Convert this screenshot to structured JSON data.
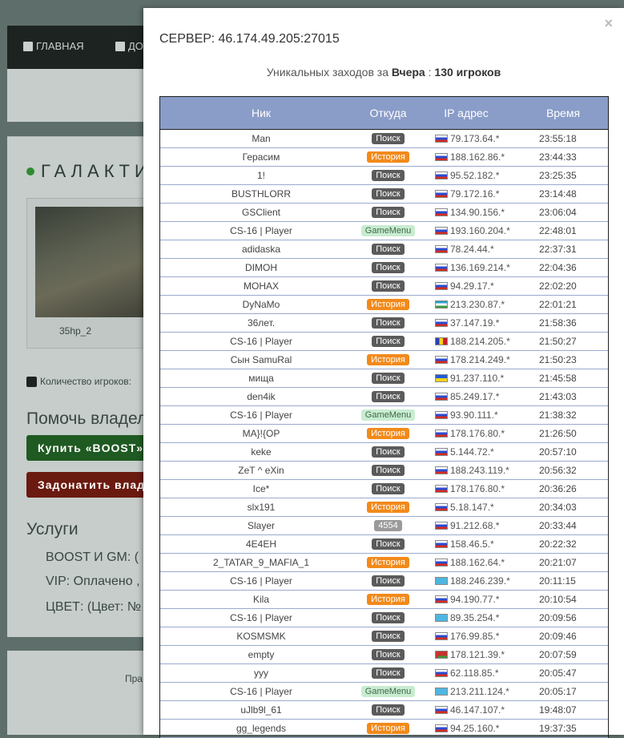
{
  "background": {
    "nav": [
      {
        "label": "ГЛАВНАЯ",
        "icon": "home-icon"
      },
      {
        "label": "ДО",
        "icon": "plus-square-icon"
      }
    ],
    "server_title": "ГАЛАКТИ",
    "map_name": "35hp_2",
    "players_label": "Количество игроков:",
    "help_heading": "Помочь владел",
    "buy_boost": "Купить «BOOST»",
    "donate": "Задонатить влад",
    "services_heading": "Услуги",
    "services": [
      "BOOST И GM:   (",
      "VIP:   Оплачено ,",
      "ЦВЕТ:   (Цвет: №"
    ],
    "footer_text": "Пра"
  },
  "modal": {
    "close": "×",
    "title": "СЕРВЕР: 46.174.49.205:27015",
    "unique_prefix": "Уникальных заходов за",
    "unique_period": "Вчера",
    "unique_sep": " : ",
    "unique_count": "130 игроков",
    "columns": {
      "nick": "Ник",
      "from": "Откуда",
      "ip": "IP адрес",
      "time": "Время"
    },
    "rows": [
      {
        "nick": "Man",
        "from": "Поиск",
        "type": "poisk",
        "flag": "ru",
        "ip": "79.173.64.*",
        "time": "23:55:18"
      },
      {
        "nick": "Герасим",
        "from": "История",
        "type": "ist",
        "flag": "ru",
        "ip": "188.162.86.*",
        "time": "23:44:33"
      },
      {
        "nick": "1!",
        "from": "Поиск",
        "type": "poisk",
        "flag": "ru",
        "ip": "95.52.182.*",
        "time": "23:25:35"
      },
      {
        "nick": "BUSTHLORR",
        "from": "Поиск",
        "type": "poisk",
        "flag": "ru",
        "ip": "79.172.16.*",
        "time": "23:14:48"
      },
      {
        "nick": "GSClient",
        "from": "Поиск",
        "type": "poisk",
        "flag": "ru",
        "ip": "134.90.156.*",
        "time": "23:06:04"
      },
      {
        "nick": "CS-16 | Player",
        "from": "GameMenu",
        "type": "gm",
        "flag": "ru",
        "ip": "193.160.204.*",
        "time": "22:48:01"
      },
      {
        "nick": "adidaska",
        "from": "Поиск",
        "type": "poisk",
        "flag": "ru",
        "ip": "78.24.44.*",
        "time": "22:37:31"
      },
      {
        "nick": "DIMOH",
        "from": "Поиск",
        "type": "poisk",
        "flag": "ru",
        "ip": "136.169.214.*",
        "time": "22:04:36"
      },
      {
        "nick": "MOHAX",
        "from": "Поиск",
        "type": "poisk",
        "flag": "ru",
        "ip": "94.29.17.*",
        "time": "22:02:20"
      },
      {
        "nick": "DyNaMo",
        "from": "История",
        "type": "ist",
        "flag": "uz",
        "ip": "213.230.87.*",
        "time": "22:01:21"
      },
      {
        "nick": "36лет.",
        "from": "Поиск",
        "type": "poisk",
        "flag": "ru",
        "ip": "37.147.19.*",
        "time": "21:58:36"
      },
      {
        "nick": "CS-16 | Player",
        "from": "Поиск",
        "type": "poisk",
        "flag": "md",
        "ip": "188.214.205.*",
        "time": "21:50:27"
      },
      {
        "nick": "Сын SamuRal",
        "from": "История",
        "type": "ist",
        "flag": "ru",
        "ip": "178.214.249.*",
        "time": "21:50:23"
      },
      {
        "nick": "мища",
        "from": "Поиск",
        "type": "poisk",
        "flag": "ua",
        "ip": "91.237.110.*",
        "time": "21:45:58"
      },
      {
        "nick": "den4ik",
        "from": "Поиск",
        "type": "poisk",
        "flag": "ru",
        "ip": "85.249.17.*",
        "time": "21:43:03"
      },
      {
        "nick": "CS-16 | Player",
        "from": "GameMenu",
        "type": "gm",
        "flag": "ru",
        "ip": "93.90.111.*",
        "time": "21:38:32"
      },
      {
        "nick": "MA}!{OP",
        "from": "История",
        "type": "ist",
        "flag": "ru",
        "ip": "178.176.80.*",
        "time": "21:26:50"
      },
      {
        "nick": "keke",
        "from": "Поиск",
        "type": "poisk",
        "flag": "ru",
        "ip": "5.144.72.*",
        "time": "20:57:10"
      },
      {
        "nick": "ZeT ^ eXin",
        "from": "Поиск",
        "type": "poisk",
        "flag": "ru",
        "ip": "188.243.119.*",
        "time": "20:56:32"
      },
      {
        "nick": "Ice*",
        "from": "Поиск",
        "type": "poisk",
        "flag": "ru",
        "ip": "178.176.80.*",
        "time": "20:36:26"
      },
      {
        "nick": "slx191",
        "from": "История",
        "type": "ist",
        "flag": "ru",
        "ip": "5.18.147.*",
        "time": "20:34:03"
      },
      {
        "nick": "Slayer",
        "from": "4554",
        "type": "num",
        "flag": "ru",
        "ip": "91.212.68.*",
        "time": "20:33:44"
      },
      {
        "nick": "4E4EH",
        "from": "Поиск",
        "type": "poisk",
        "flag": "ru",
        "ip": "158.46.5.*",
        "time": "20:22:32"
      },
      {
        "nick": "2_TATAR_9_MAFIA_1",
        "from": "История",
        "type": "ist",
        "flag": "ru",
        "ip": "188.162.64.*",
        "time": "20:21:07"
      },
      {
        "nick": "CS-16 | Player",
        "from": "Поиск",
        "type": "poisk",
        "flag": "kz",
        "ip": "188.246.239.*",
        "time": "20:11:15"
      },
      {
        "nick": "Kila",
        "from": "История",
        "type": "ist",
        "flag": "ru",
        "ip": "94.190.77.*",
        "time": "20:10:54"
      },
      {
        "nick": "CS-16 | Player",
        "from": "Поиск",
        "type": "poisk",
        "flag": "kz",
        "ip": "89.35.254.*",
        "time": "20:09:56"
      },
      {
        "nick": "KOSMSMK",
        "from": "Поиск",
        "type": "poisk",
        "flag": "ru",
        "ip": "176.99.85.*",
        "time": "20:09:46"
      },
      {
        "nick": "empty",
        "from": "Поиск",
        "type": "poisk",
        "flag": "by",
        "ip": "178.121.39.*",
        "time": "20:07:59"
      },
      {
        "nick": "yyy",
        "from": "Поиск",
        "type": "poisk",
        "flag": "ru",
        "ip": "62.118.85.*",
        "time": "20:05:47"
      },
      {
        "nick": "CS-16 | Player",
        "from": "GameMenu",
        "type": "gm",
        "flag": "kz",
        "ip": "213.211.124.*",
        "time": "20:05:17"
      },
      {
        "nick": "uJlb9l_61",
        "from": "Поиск",
        "type": "poisk",
        "flag": "ru",
        "ip": "46.147.107.*",
        "time": "19:48:07"
      },
      {
        "nick": "gg_legends",
        "from": "История",
        "type": "ist",
        "flag": "ru",
        "ip": "94.25.160.*",
        "time": "19:37:35"
      }
    ]
  }
}
